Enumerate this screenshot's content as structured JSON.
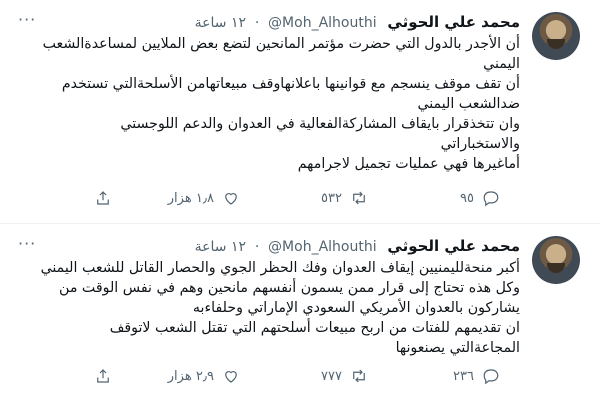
{
  "tweets": [
    {
      "name": "محمد علي الحوثي",
      "handle": "@Moh_Alhouthi",
      "time": "١٢ ساعة",
      "lines": [
        "أن الأجدر بالدول التي حضرت مؤتمر المانحين لتضع بعض الملايين لمساعدةالشعب",
        "اليمني",
        "أن تقف موقف ينسجم مع قوانينها باعلانهاوقف مبيعاتهامن الأسلحةالتي تستخدم",
        "ضدالشعب اليمني",
        "وان تتخذقرار بايقاف المشاركةالفعالية في العدوان والدعم اللوجستي",
        "والاستخباراتي",
        "أماغيرها فهي عمليات تجميل لاجرامهم"
      ],
      "stats": {
        "replies": "٩٥",
        "retweets": "٥٣٢",
        "likes": "١٫٨ هزار"
      }
    },
    {
      "name": "محمد علي الحوثي",
      "handle": "@Moh_Alhouthi",
      "time": "١٢ ساعة",
      "lines": [
        "أكبر منحةلليمنيين إيقاف العدوان وفك الحظر الجوي والحصار القاتل للشعب اليمني",
        "وكل هذه تحتاج إلى قرار ممن يسمون أنفسهم مانحين وهم في نفس الوقت من",
        "يشاركون بالعدوان الأمريكي السعودي الإماراتي وحلفاءبه",
        "ان تقديمهم للفتات من اربح مبيعات أسلحتهم التي تقتل الشعب لاتوقف",
        "المجاعةالتي يصنعونها"
      ],
      "stats": {
        "replies": "٢٣٦",
        "retweets": "٧٧٧",
        "likes": "٢٫٩ هزار"
      }
    }
  ],
  "icons": [
    "avatar",
    "more-icon",
    "reply-icon",
    "retweet-icon",
    "like-icon",
    "share-icon"
  ],
  "colors": {
    "text": "#0f1419",
    "muted": "#536471",
    "divider": "#eff3f4"
  }
}
